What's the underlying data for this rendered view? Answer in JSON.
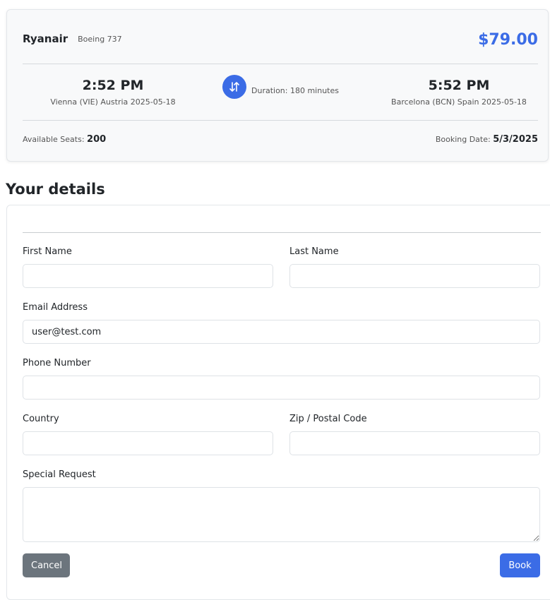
{
  "flight": {
    "airline": "Ryanair",
    "aircraft": "Boeing 737",
    "price": "$79.00",
    "departure": {
      "time": "2:52 PM",
      "place": "Vienna (VIE) Austria 2025-05-18"
    },
    "arrival": {
      "time": "5:52 PM",
      "place": "Barcelona (BCN) Spain 2025-05-18"
    },
    "duration": "Duration: 180 minutes",
    "seats_label": "Available Seats:",
    "seats_value": "200",
    "booking_label": "Booking Date:",
    "booking_value": "5/3/2025"
  },
  "details": {
    "title": "Your details",
    "first_name": {
      "label": "First Name",
      "value": ""
    },
    "last_name": {
      "label": "Last Name",
      "value": ""
    },
    "email": {
      "label": "Email Address",
      "value": "user@test.com"
    },
    "phone": {
      "label": "Phone Number",
      "value": ""
    },
    "country": {
      "label": "Country",
      "value": ""
    },
    "zip": {
      "label": "Zip / Postal Code",
      "value": ""
    },
    "special_request": {
      "label": "Special Request",
      "value": ""
    },
    "cancel_label": "Cancel",
    "book_label": "Book"
  },
  "colors": {
    "accent": "#3b6ce6",
    "secondary": "#6c757d"
  }
}
